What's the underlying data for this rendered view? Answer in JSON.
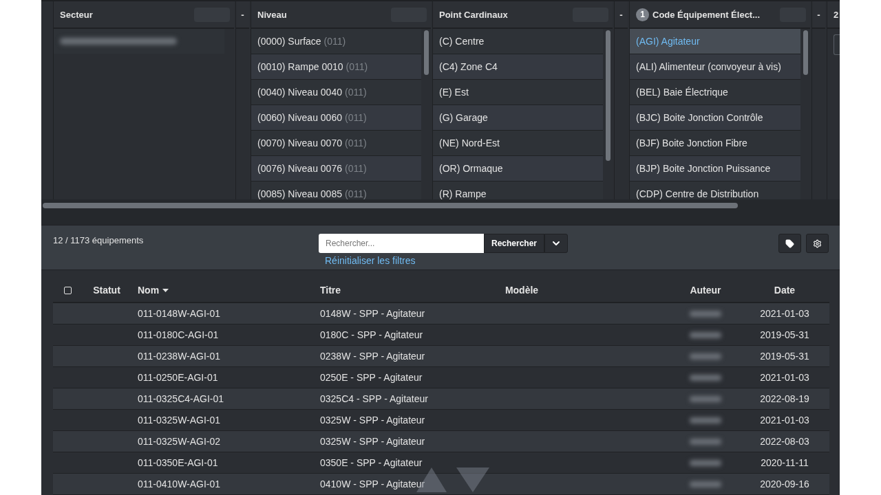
{
  "filter_columns": [
    {
      "title": "Secteur",
      "toggle": "-",
      "items": [
        {
          "kind": "redacted",
          "selected": false
        }
      ]
    },
    {
      "title": "Niveau",
      "items": [
        {
          "kind": "text",
          "label": "(0000) Surface",
          "count": "(011)",
          "selected": false
        },
        {
          "kind": "text",
          "label": "(0010) Rampe 0010",
          "count": "(011)",
          "selected": false
        },
        {
          "kind": "text",
          "label": "(0040) Niveau 0040",
          "count": "(011)",
          "selected": false
        },
        {
          "kind": "text",
          "label": "(0060) Niveau 0060",
          "count": "(011)",
          "selected": false
        },
        {
          "kind": "text",
          "label": "(0070) Niveau 0070",
          "count": "(011)",
          "selected": false
        },
        {
          "kind": "text",
          "label": "(0076) Niveau 0076",
          "count": "(011)",
          "selected": false
        },
        {
          "kind": "text",
          "label": "(0085) Niveau 0085",
          "count": "(011)",
          "selected": false
        }
      ]
    },
    {
      "title": "Point Cardinaux",
      "toggle": "-",
      "items": [
        {
          "kind": "text",
          "label": "(C) Centre",
          "selected": false
        },
        {
          "kind": "text",
          "label": "(C4) Zone C4",
          "selected": false
        },
        {
          "kind": "text",
          "label": "(E) Est",
          "selected": false
        },
        {
          "kind": "text",
          "label": "(G) Garage",
          "selected": false
        },
        {
          "kind": "text",
          "label": "(NE) Nord-Est",
          "selected": false
        },
        {
          "kind": "text",
          "label": "(OR) Ormaque",
          "selected": false
        },
        {
          "kind": "text",
          "label": "(R) Rampe",
          "selected": false
        }
      ]
    },
    {
      "title": "Code Équipement Élect...",
      "badge": "1",
      "toggle": "-",
      "items": [
        {
          "kind": "text",
          "label": "(AGI) Agitateur",
          "selected": true
        },
        {
          "kind": "text",
          "label": "(ALI) Alimenteur (convoyeur à vis)",
          "selected": false
        },
        {
          "kind": "text",
          "label": "(BEL) Baie Électrique",
          "selected": false
        },
        {
          "kind": "text",
          "label": "(BJC) Boite Jonction Contrôle",
          "selected": false
        },
        {
          "kind": "text",
          "label": "(BJF) Boite Jonction Fibre",
          "selected": false
        },
        {
          "kind": "text",
          "label": "(BJP) Boite Jonction Puissance",
          "selected": false
        },
        {
          "kind": "text",
          "label": "(CDP) Centre de Distribution",
          "selected": false
        }
      ]
    },
    {
      "title": "2",
      "partial": true
    }
  ],
  "toolbar": {
    "count": "12 / 1173 équipements",
    "search": {
      "placeholder": "Rechercher..."
    },
    "search_button": "Rechercher",
    "reset_link": "Réinitialiser les filtres"
  },
  "table": {
    "select_all": {
      "checked": false
    },
    "columns": [
      {
        "label": "Statut",
        "sorted": false
      },
      {
        "label": "Nom",
        "sorted": true
      },
      {
        "label": "Titre",
        "sorted": false
      },
      {
        "label": "Modèle",
        "sorted": false
      },
      {
        "label": "Auteur",
        "sorted": false
      },
      {
        "label": "Date",
        "sorted": false
      }
    ],
    "rows": [
      {
        "nom": "011-0148W-AGI-01",
        "titre": "0148W - SPP - Agitateur",
        "author_redacted": true,
        "date": "2021-01-03"
      },
      {
        "nom": "011-0180C-AGI-01",
        "titre": "0180C - SPP - Agitateur",
        "author_redacted": true,
        "date": "2019-05-31"
      },
      {
        "nom": "011-0238W-AGI-01",
        "titre": "0238W - SPP - Agitateur",
        "author_redacted": true,
        "date": "2019-05-31"
      },
      {
        "nom": "011-0250E-AGI-01",
        "titre": "0250E - SPP - Agitateur",
        "author_redacted": true,
        "date": "2021-01-03"
      },
      {
        "nom": "011-0325C4-AGI-01",
        "titre": "0325C4 - SPP - Agitateur",
        "author_redacted": true,
        "date": "2022-08-19"
      },
      {
        "nom": "011-0325W-AGI-01",
        "titre": "0325W - SPP - Agitateur",
        "author_redacted": true,
        "date": "2021-01-03"
      },
      {
        "nom": "011-0325W-AGI-02",
        "titre": "0325W - SPP - Agitateur",
        "author_redacted": true,
        "date": "2022-08-03"
      },
      {
        "nom": "011-0350E-AGI-01",
        "titre": "0350E - SPP - Agitateur",
        "author_redacted": true,
        "date": "2020-11-11"
      },
      {
        "nom": "011-0410W-AGI-01",
        "titre": "0410W - SPP - Agitateur",
        "author_redacted": true,
        "date": "2020-09-16"
      }
    ]
  }
}
